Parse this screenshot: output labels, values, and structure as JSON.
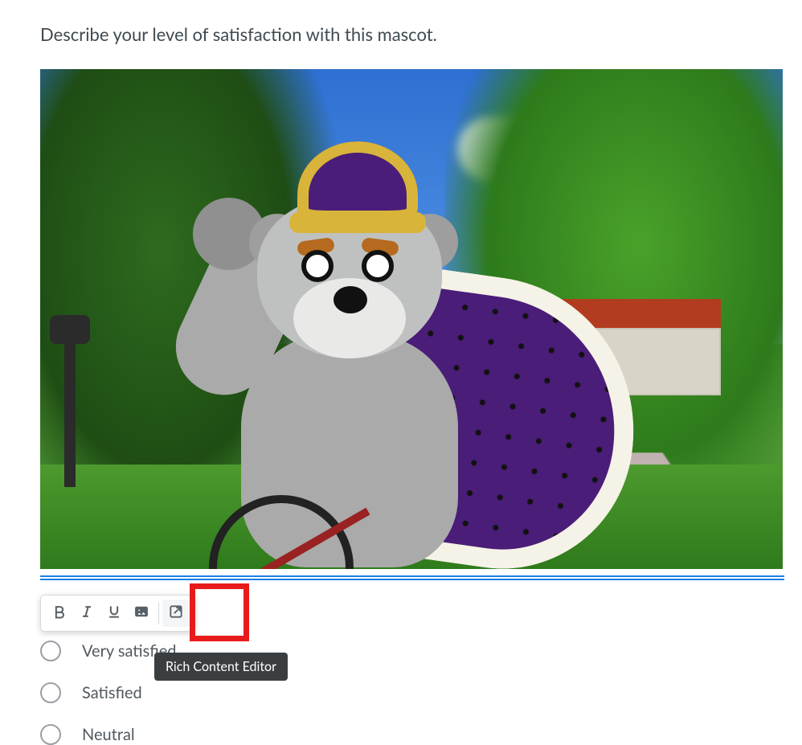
{
  "question": {
    "prompt": "Describe your level of satisfaction with this mascot."
  },
  "toolbar": {
    "bold_label": "Bold",
    "italic_label": "Italic",
    "underline_label": "Underline",
    "image_label": "Insert image",
    "external_label": "Open Rich Content Editor"
  },
  "tooltip": {
    "text": "Rich Content Editor"
  },
  "choices": [
    {
      "label": "Very satisfied"
    },
    {
      "label": "Satisfied"
    },
    {
      "label": "Neutral"
    }
  ]
}
